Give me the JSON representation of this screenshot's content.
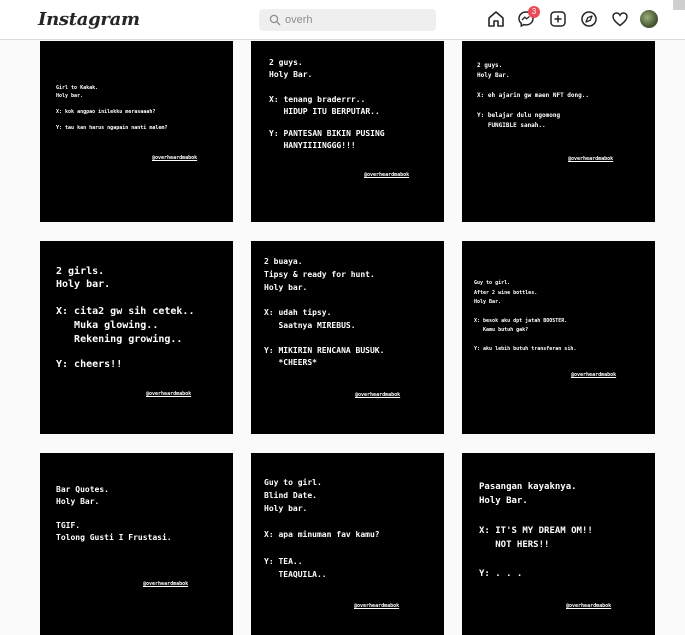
{
  "header": {
    "logo": "Instagram",
    "search_value": "overh",
    "notification_count": "3",
    "icons": [
      "home-icon",
      "messenger-icon",
      "new-post-icon",
      "explore-icon",
      "activity-heart-icon",
      "profile-avatar"
    ]
  },
  "posts": [
    {
      "lines": [
        "Girl to Kakak.",
        "Holy bar.",
        "",
        "X: kok angpao inilekku merasaaah?",
        "",
        "Y: tau kan harus ngapain nanti malem?"
      ],
      "credit": "@overheardmabok"
    },
    {
      "lines": [
        "2 guys.",
        "Holy Bar.",
        "",
        "X: tenang braderrr..",
        "   HIDUP ITU BERPUTAR..",
        "",
        "Y: PANTESAN BIKIN PUSING",
        "   HANYIIIINGGG!!!"
      ],
      "credit": "@overheardmabok"
    },
    {
      "lines": [
        "2 guys.",
        "Holy Bar.",
        "",
        "X: eh ajarin gw maen NFT dong..",
        "",
        "Y: belajar dulu ngomong",
        "   FUNGIBLE sanah.."
      ],
      "credit": "@overheardmabok"
    },
    {
      "lines": [
        "2 girls.",
        "Holy bar.",
        "",
        "X: cita2 gw sih cetek..",
        "   Muka glowing..",
        "   Rekening growing..",
        "",
        "Y: cheers!!"
      ],
      "credit": "@overheardmabok"
    },
    {
      "lines": [
        "2 buaya.",
        "Tipsy & ready for hunt.",
        "Holy bar.",
        "",
        "X: udah tipsy.",
        "   Saatnya MIREBUS.",
        "",
        "Y: MIKIRIN RENCANA BUSUK.",
        "   *CHEERS*"
      ],
      "credit": "@overheardmabok"
    },
    {
      "lines": [
        "Guy to girl.",
        "After 2 wine bottles.",
        "Holy Bar.",
        "",
        "X: besok aku dpt jatah BOOSTER.",
        "   Kamu butuh gak?",
        "",
        "Y: aku lebih butuh transferan sih."
      ],
      "credit": "@overheardmabok"
    },
    {
      "lines": [
        "Bar Quotes.",
        "Holy Bar.",
        "",
        "TGIF.",
        "Tolong Gusti I Frustasi."
      ],
      "credit": "@overheardmabok"
    },
    {
      "lines": [
        "Guy to girl.",
        "Blind Date.",
        "Holy bar.",
        "",
        "X: apa minuman fav kamu?",
        "",
        "Y: TEA..",
        "   TEAQUILA.."
      ],
      "credit": "@overheardmabok"
    },
    {
      "lines": [
        "Pasangan kayaknya.",
        "Holy Bar.",
        "",
        "X: IT'S MY DREAM OM!!",
        "   NOT HERS!!",
        "",
        "Y: . . ."
      ],
      "credit": "@overheardmabok"
    }
  ]
}
